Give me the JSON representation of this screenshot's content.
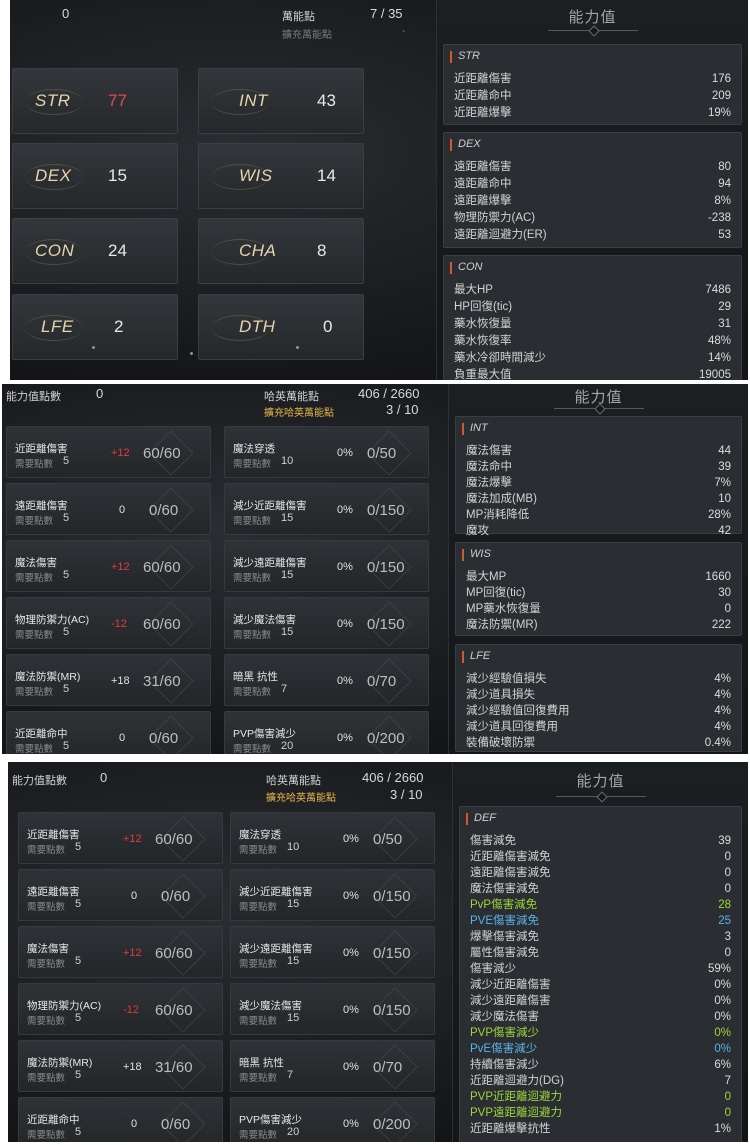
{
  "panel1": {
    "points": "0",
    "title": "萬能點",
    "count": "7 / 35",
    "refill": "擴充萬能點",
    "refill_val": "-",
    "right_title": "能力值",
    "stats": [
      {
        "name": "STR",
        "value": "77"
      },
      {
        "name": "INT",
        "value": "43"
      },
      {
        "name": "DEX",
        "value": "15"
      },
      {
        "name": "WIS",
        "value": "14"
      },
      {
        "name": "CON",
        "value": "24"
      },
      {
        "name": "CHA",
        "value": "8"
      },
      {
        "name": "LFE",
        "value": "2"
      },
      {
        "name": "DTH",
        "value": "0"
      }
    ],
    "sections": [
      {
        "name": "STR",
        "rows": [
          {
            "label": "近距離傷害",
            "value": "176"
          },
          {
            "label": "近距離命中",
            "value": "209"
          },
          {
            "label": "近距離爆擊",
            "value": "19%"
          }
        ]
      },
      {
        "name": "DEX",
        "rows": [
          {
            "label": "遠距離傷害",
            "value": "80"
          },
          {
            "label": "遠距離命中",
            "value": "94"
          },
          {
            "label": "遠距離爆擊",
            "value": "8%"
          },
          {
            "label": "物理防禦力(AC)",
            "value": "-238"
          },
          {
            "label": "遠距離迴避力(ER)",
            "value": "53"
          }
        ]
      },
      {
        "name": "CON",
        "rows": [
          {
            "label": "最大HP",
            "value": "7486"
          },
          {
            "label": "HP回復(tic)",
            "value": "29"
          },
          {
            "label": "藥水恢復量",
            "value": "31"
          },
          {
            "label": "藥水恢復率",
            "value": "48%"
          },
          {
            "label": "藥水冷卻時間減少",
            "value": "14%"
          },
          {
            "label": "負重最大值",
            "value": "19005"
          }
        ]
      }
    ]
  },
  "panel2": {
    "points_label": "能力值點數",
    "points": "0",
    "hayan_label": "哈英萬能點",
    "hayan_val": "406 / 2660",
    "ext_label": "擴充哈英萬能點",
    "ext_val": "3 / 10",
    "req_label": "需要點數",
    "right_title": "能力值",
    "left_cards": [
      {
        "label": "近距離傷害",
        "req": "5",
        "bonus": "+12",
        "progress": "60/60"
      },
      {
        "label": "遠距離傷害",
        "req": "5",
        "bonus": "0",
        "progress": "0/60"
      },
      {
        "label": "魔法傷害",
        "req": "5",
        "bonus": "+12",
        "progress": "60/60"
      },
      {
        "label": "物理防禦力(AC)",
        "req": "5",
        "bonus": "-12",
        "progress": "60/60"
      },
      {
        "label": "魔法防禦(MR)",
        "req": "5",
        "bonus": "+18",
        "progress": "31/60"
      },
      {
        "label": "近距離命中",
        "req": "5",
        "bonus": "0",
        "progress": "0/60"
      }
    ],
    "right_cards": [
      {
        "label": "魔法穿透",
        "req": "10",
        "bonus": "0%",
        "progress": "0/50"
      },
      {
        "label": "減少近距離傷害",
        "req": "15",
        "bonus": "0%",
        "progress": "0/150"
      },
      {
        "label": "減少遠距離傷害",
        "req": "15",
        "bonus": "0%",
        "progress": "0/150"
      },
      {
        "label": "減少魔法傷害",
        "req": "15",
        "bonus": "0%",
        "progress": "0/150"
      },
      {
        "label": "暗黑 抗性",
        "req": "7",
        "bonus": "0%",
        "progress": "0/70"
      },
      {
        "label": "PVP傷害減少",
        "req": "20",
        "bonus": "0%",
        "progress": "0/200"
      }
    ],
    "sections": [
      {
        "name": "INT",
        "rows": [
          {
            "label": "魔法傷害",
            "value": "44"
          },
          {
            "label": "魔法命中",
            "value": "39"
          },
          {
            "label": "魔法爆擊",
            "value": "7%"
          },
          {
            "label": "魔法加成(MB)",
            "value": "10"
          },
          {
            "label": "MP消耗降低",
            "value": "28%"
          },
          {
            "label": "魔攻",
            "value": "42"
          }
        ]
      },
      {
        "name": "WIS",
        "rows": [
          {
            "label": "最大MP",
            "value": "1660"
          },
          {
            "label": "MP回復(tic)",
            "value": "30"
          },
          {
            "label": "MP藥水恢復量",
            "value": "0"
          },
          {
            "label": "魔法防禦(MR)",
            "value": "222"
          }
        ]
      },
      {
        "name": "LFE",
        "rows": [
          {
            "label": "減少經驗值損失",
            "value": "4%"
          },
          {
            "label": "減少道具損失",
            "value": "4%"
          },
          {
            "label": "減少經驗值回復費用",
            "value": "4%"
          },
          {
            "label": "減少道具回復費用",
            "value": "4%"
          },
          {
            "label": "裝備破壞防禦",
            "value": "0.4%"
          }
        ]
      }
    ]
  },
  "panel3": {
    "points_label": "能力值點數",
    "points": "0",
    "hayan_label": "哈英萬能點",
    "hayan_val": "406 / 2660",
    "ext_label": "擴充哈英萬能點",
    "ext_val": "3 / 10",
    "req_label": "需要點數",
    "right_title": "能力值",
    "left_cards": [
      {
        "label": "近距離傷害",
        "req": "5",
        "bonus": "+12",
        "progress": "60/60"
      },
      {
        "label": "遠距離傷害",
        "req": "5",
        "bonus": "0",
        "progress": "0/60"
      },
      {
        "label": "魔法傷害",
        "req": "5",
        "bonus": "+12",
        "progress": "60/60"
      },
      {
        "label": "物理防禦力(AC)",
        "req": "5",
        "bonus": "-12",
        "progress": "60/60"
      },
      {
        "label": "魔法防禦(MR)",
        "req": "5",
        "bonus": "+18",
        "progress": "31/60"
      },
      {
        "label": "近距離命中",
        "req": "5",
        "bonus": "0",
        "progress": "0/60"
      }
    ],
    "right_cards": [
      {
        "label": "魔法穿透",
        "req": "10",
        "bonus": "0%",
        "progress": "0/50"
      },
      {
        "label": "減少近距離傷害",
        "req": "15",
        "bonus": "0%",
        "progress": "0/150"
      },
      {
        "label": "減少遠距離傷害",
        "req": "15",
        "bonus": "0%",
        "progress": "0/150"
      },
      {
        "label": "減少魔法傷害",
        "req": "15",
        "bonus": "0%",
        "progress": "0/150"
      },
      {
        "label": "暗黑 抗性",
        "req": "7",
        "bonus": "0%",
        "progress": "0/70"
      },
      {
        "label": "PVP傷害減少",
        "req": "20",
        "bonus": "0%",
        "progress": "0/200"
      }
    ],
    "def_section": {
      "name": "DEF",
      "rows": [
        {
          "label": "傷害減免",
          "value": "39",
          "color": "normal"
        },
        {
          "label": "近距離傷害減免",
          "value": "0",
          "color": "normal"
        },
        {
          "label": "遠距離傷害減免",
          "value": "0",
          "color": "normal"
        },
        {
          "label": "魔法傷害減免",
          "value": "0",
          "color": "normal"
        },
        {
          "label": "PvP傷害減免",
          "value": "28",
          "color": "green"
        },
        {
          "label": "PVE傷害減免",
          "value": "25",
          "color": "blue"
        },
        {
          "label": "爆擊傷害減免",
          "value": "3",
          "color": "normal"
        },
        {
          "label": "屬性傷害減免",
          "value": "0",
          "color": "normal"
        },
        {
          "label": "傷害減少",
          "value": "59%",
          "color": "normal"
        },
        {
          "label": "減少近距離傷害",
          "value": "0%",
          "color": "normal"
        },
        {
          "label": "減少遠距離傷害",
          "value": "0%",
          "color": "normal"
        },
        {
          "label": "減少魔法傷害",
          "value": "0%",
          "color": "normal"
        },
        {
          "label": "PVP傷害減少",
          "value": "0%",
          "color": "green"
        },
        {
          "label": "PvE傷害減少",
          "value": "0%",
          "color": "blue"
        },
        {
          "label": "持續傷害減少",
          "value": "6%",
          "color": "normal"
        },
        {
          "label": "近距離迴避力(DG)",
          "value": "7",
          "color": "normal"
        },
        {
          "label": "PVP近距離迴避力",
          "value": "0",
          "color": "green"
        },
        {
          "label": "PVP遠距離迴避力",
          "value": "0",
          "color": "green"
        },
        {
          "label": "近距離爆擊抗性",
          "value": "1%",
          "color": "normal"
        }
      ]
    }
  },
  "colors": {
    "accent_bar": "#d25a2a",
    "gold": "#e4b64a",
    "red_value": "#e24848",
    "green_value": "#9ed63a",
    "blue_value": "#5ab4e6"
  }
}
